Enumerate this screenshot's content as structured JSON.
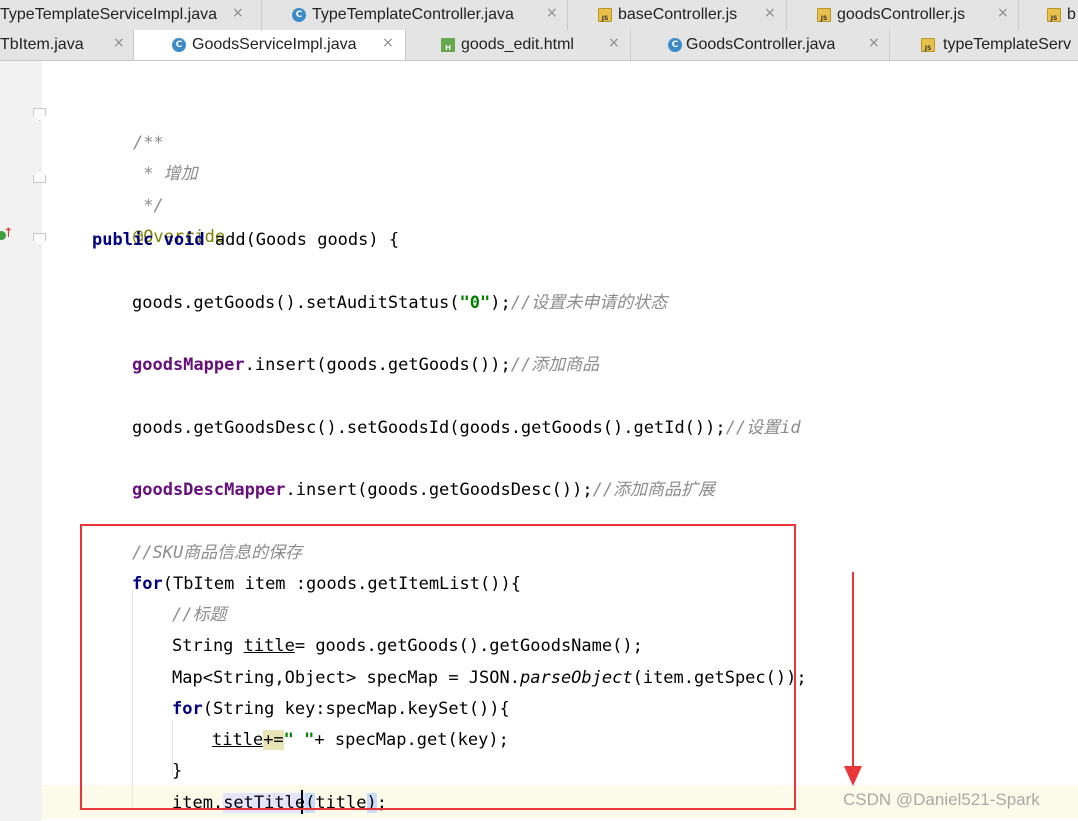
{
  "tabs_row1": [
    {
      "label": "TypeTemplateServiceImpl.java",
      "icon": "none",
      "close": "×"
    },
    {
      "label": "TypeTemplateController.java",
      "icon": "class-icon",
      "close": "×"
    },
    {
      "label": "baseController.js",
      "icon": "js-file-icon",
      "close": "×"
    },
    {
      "label": "goodsController.js",
      "icon": "js-file-icon",
      "close": "×"
    },
    {
      "label": "b",
      "icon": "js-file-icon",
      "close": ""
    }
  ],
  "tabs_row2": [
    {
      "label": "TbItem.java",
      "icon": "none",
      "close": "×"
    },
    {
      "label": "GoodsServiceImpl.java",
      "icon": "class-icon",
      "close": "×",
      "active": true
    },
    {
      "label": "goods_edit.html",
      "icon": "html-file-icon",
      "close": "×"
    },
    {
      "label": "GoodsController.java",
      "icon": "class-icon",
      "close": "×"
    },
    {
      "label": "typeTemplateServ",
      "icon": "js-file-icon",
      "close": ""
    }
  ],
  "icon_letters": {
    "class": "C",
    "js": "JS",
    "html": "H"
  },
  "code": {
    "doc_open": "/**",
    "doc_body": " * 增加",
    "doc_close": " */",
    "annotation": "@Override",
    "kw_public": "public",
    "kw_void": "void",
    "method_sig": " add(Goods goods) {",
    "l1_a": "goods.getGoods().setAuditStatus(",
    "l1_str": "\"0\"",
    "l1_b": ");",
    "l1_cm": "//设置未申请的状态",
    "l2_fld": "goodsMapper",
    "l2_a": ".insert(goods.getGoods());",
    "l2_cm": "//添加商品",
    "l3_a": "goods.getGoodsDesc().setGoodsId(goods.getGoods().getId());",
    "l3_cm": "//设置id",
    "l4_fld": "goodsDescMapper",
    "l4_a": ".insert(goods.getGoodsDesc());",
    "l4_cm": "//添加商品扩展",
    "l5_cm": "//SKU商品信息的保存",
    "l6_kw": "for",
    "l6_a": "(TbItem item :goods.getItemList()){",
    "l7_cm": "//标题",
    "l8_a": "String ",
    "l8_var": "title",
    "l8_b": "= goods.getGoods().getGoodsName();",
    "l9_a": "Map<String,Object> specMap = JSON.",
    "l9_st": "parseObject",
    "l9_b": "(item.getSpec());",
    "l10_kw": "for",
    "l10_a": "(String key:specMap.keySet()){",
    "l11_var": "title",
    "l11_op": "+=",
    "l11_str": "\" \"",
    "l11_b": "+ specMap.get(key);",
    "l12": "}",
    "l13_a": "item.",
    "l13_m": "setTitle",
    "l13_p1": "(",
    "l13_arg": "title",
    "l13_p2": ")",
    "l13_b": ";"
  },
  "watermark": "CSDN @Daniel521-Spark",
  "colors": {
    "keyword": "#000080",
    "comment": "#8c8c8c",
    "annotation": "#808000",
    "field": "#660e7a",
    "string": "#008000",
    "highlight_box": "#e8353a"
  }
}
